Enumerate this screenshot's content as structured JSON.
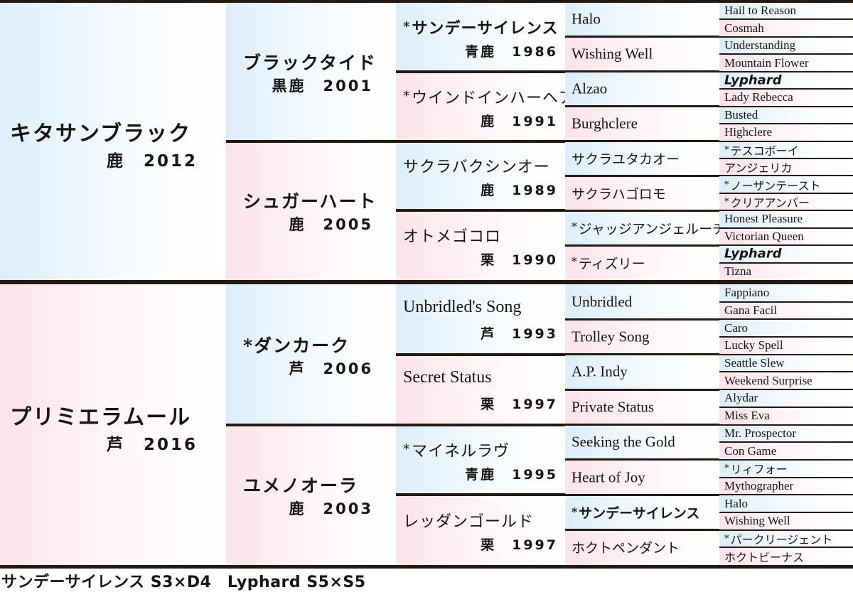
{
  "meta": {
    "accent_blue": "#ddeefb",
    "accent_pink": "#fbe3ea",
    "rule_color": "#241a14"
  },
  "gen1": [
    {
      "name": "キタサンブラック",
      "coat": "鹿",
      "year": "2012",
      "sex": "male"
    },
    {
      "name": "プリミエラムール",
      "coat": "芦",
      "year": "2016",
      "sex": "female"
    }
  ],
  "gen2": [
    {
      "name": "ブラックタイド",
      "coat": "黒鹿",
      "year": "2001",
      "sex": "male"
    },
    {
      "name": "シュガーハート",
      "coat": "鹿",
      "year": "2005",
      "sex": "female"
    },
    {
      "name": "*ダンカーク",
      "coat": "芦",
      "year": "2006",
      "sex": "male"
    },
    {
      "name": "ユメノオーラ",
      "coat": "鹿",
      "year": "2003",
      "sex": "female"
    }
  ],
  "gen3": [
    {
      "name": "サンデーサイレンス",
      "star": true,
      "bold": true,
      "script": "jp",
      "coat": "青鹿",
      "year": "1986",
      "sex": "male"
    },
    {
      "name": "ウインドインハーヘア",
      "star": true,
      "bold": false,
      "script": "jp",
      "coat": "鹿",
      "year": "1991",
      "sex": "female"
    },
    {
      "name": "サクラバクシンオー",
      "star": false,
      "bold": false,
      "script": "jp",
      "coat": "鹿",
      "year": "1989",
      "sex": "male"
    },
    {
      "name": "オトメゴコロ",
      "star": false,
      "bold": false,
      "script": "jp",
      "coat": "栗",
      "year": "1990",
      "sex": "female"
    },
    {
      "name": "Unbridled's Song",
      "star": false,
      "bold": false,
      "script": "en",
      "coat": "芦",
      "year": "1993",
      "sex": "male"
    },
    {
      "name": "Secret Status",
      "star": false,
      "bold": false,
      "script": "en",
      "coat": "栗",
      "year": "1997",
      "sex": "female"
    },
    {
      "name": "マイネルラヴ",
      "star": true,
      "bold": false,
      "script": "jp",
      "coat": "青鹿",
      "year": "1995",
      "sex": "male"
    },
    {
      "name": "レッダンゴールド",
      "star": false,
      "bold": false,
      "script": "jp",
      "coat": "栗",
      "year": "1997",
      "sex": "female"
    }
  ],
  "gen4": [
    {
      "name": "Halo",
      "star": false,
      "bold": false,
      "script": "en",
      "sex": "male"
    },
    {
      "name": "Wishing Well",
      "star": false,
      "bold": false,
      "script": "en",
      "sex": "female"
    },
    {
      "name": "Alzao",
      "star": false,
      "bold": false,
      "script": "en",
      "sex": "male"
    },
    {
      "name": "Burghclere",
      "star": false,
      "bold": false,
      "script": "en",
      "sex": "female"
    },
    {
      "name": "サクラユタカオー",
      "star": false,
      "bold": false,
      "script": "jp",
      "sex": "male"
    },
    {
      "name": "サクラハゴロモ",
      "star": false,
      "bold": false,
      "script": "jp",
      "sex": "female"
    },
    {
      "name": "ジャッジアンジェルーチ",
      "star": true,
      "bold": false,
      "script": "jp",
      "sex": "male"
    },
    {
      "name": "ティズリー",
      "star": true,
      "bold": false,
      "script": "jp",
      "sex": "female"
    },
    {
      "name": "Unbridled",
      "star": false,
      "bold": false,
      "script": "en",
      "sex": "male"
    },
    {
      "name": "Trolley Song",
      "star": false,
      "bold": false,
      "script": "en",
      "sex": "female"
    },
    {
      "name": "A.P. Indy",
      "star": false,
      "bold": false,
      "script": "en",
      "sex": "male"
    },
    {
      "name": "Private Status",
      "star": false,
      "bold": false,
      "script": "en",
      "sex": "female"
    },
    {
      "name": "Seeking the Gold",
      "star": false,
      "bold": false,
      "script": "en",
      "sex": "male"
    },
    {
      "name": "Heart of Joy",
      "star": false,
      "bold": false,
      "script": "en",
      "sex": "female"
    },
    {
      "name": "サンデーサイレンス",
      "star": true,
      "bold": true,
      "script": "jp",
      "sex": "male"
    },
    {
      "name": "ホクトペンダント",
      "star": false,
      "bold": false,
      "script": "jp",
      "sex": "female"
    }
  ],
  "gen5": [
    {
      "name": "Hail to Reason",
      "star": false,
      "script": "en",
      "highlight": false,
      "sex": "male"
    },
    {
      "name": "Cosmah",
      "star": false,
      "script": "en",
      "highlight": false,
      "sex": "female"
    },
    {
      "name": "Understanding",
      "star": false,
      "script": "en",
      "highlight": false,
      "sex": "male"
    },
    {
      "name": "Mountain Flower",
      "star": false,
      "script": "en",
      "highlight": false,
      "sex": "female"
    },
    {
      "name": "Lyphard",
      "star": false,
      "script": "en",
      "highlight": true,
      "sex": "male"
    },
    {
      "name": "Lady Rebecca",
      "star": false,
      "script": "en",
      "highlight": false,
      "sex": "female"
    },
    {
      "name": "Busted",
      "star": false,
      "script": "en",
      "highlight": false,
      "sex": "male"
    },
    {
      "name": "Highclere",
      "star": false,
      "script": "en",
      "highlight": false,
      "sex": "female"
    },
    {
      "name": "テスコボーイ",
      "star": true,
      "script": "jp",
      "highlight": false,
      "sex": "male"
    },
    {
      "name": "アンジェリカ",
      "star": false,
      "script": "jp",
      "highlight": false,
      "sex": "female"
    },
    {
      "name": "ノーザンテースト",
      "star": true,
      "script": "jp",
      "highlight": false,
      "sex": "male"
    },
    {
      "name": "クリアアンバー",
      "star": true,
      "script": "jp",
      "highlight": false,
      "sex": "female"
    },
    {
      "name": "Honest Pleasure",
      "star": false,
      "script": "en",
      "highlight": false,
      "sex": "male"
    },
    {
      "name": "Victorian Queen",
      "star": false,
      "script": "en",
      "highlight": false,
      "sex": "female"
    },
    {
      "name": "Lyphard",
      "star": false,
      "script": "en",
      "highlight": true,
      "sex": "male"
    },
    {
      "name": "Tizna",
      "star": false,
      "script": "en",
      "highlight": false,
      "sex": "female"
    },
    {
      "name": "Fappiano",
      "star": false,
      "script": "en",
      "highlight": false,
      "sex": "male"
    },
    {
      "name": "Gana Facil",
      "star": false,
      "script": "en",
      "highlight": false,
      "sex": "female"
    },
    {
      "name": "Caro",
      "star": false,
      "script": "en",
      "highlight": false,
      "sex": "male"
    },
    {
      "name": "Lucky Spell",
      "star": false,
      "script": "en",
      "highlight": false,
      "sex": "female"
    },
    {
      "name": "Seattle Slew",
      "star": false,
      "script": "en",
      "highlight": false,
      "sex": "male"
    },
    {
      "name": "Weekend Surprise",
      "star": false,
      "script": "en",
      "highlight": false,
      "sex": "female"
    },
    {
      "name": "Alydar",
      "star": false,
      "script": "en",
      "highlight": false,
      "sex": "male"
    },
    {
      "name": "Miss Eva",
      "star": false,
      "script": "en",
      "highlight": false,
      "sex": "female"
    },
    {
      "name": "Mr. Prospector",
      "star": false,
      "script": "en",
      "highlight": false,
      "sex": "male"
    },
    {
      "name": "Con Game",
      "star": false,
      "script": "en",
      "highlight": false,
      "sex": "female"
    },
    {
      "name": "リィフォー",
      "star": true,
      "script": "jp",
      "highlight": false,
      "sex": "male"
    },
    {
      "name": "Mythographer",
      "star": false,
      "script": "en",
      "highlight": false,
      "sex": "female"
    },
    {
      "name": "Halo",
      "star": false,
      "script": "en",
      "highlight": false,
      "sex": "male"
    },
    {
      "name": "Wishing Well",
      "star": false,
      "script": "en",
      "highlight": false,
      "sex": "female"
    },
    {
      "name": "パークリージェント",
      "star": true,
      "script": "jp",
      "highlight": false,
      "sex": "male"
    },
    {
      "name": "ホクトビーナス",
      "star": false,
      "script": "jp",
      "highlight": false,
      "sex": "female"
    }
  ],
  "footer": {
    "inbreeding": "サンデーサイレンス S3×D4　Lyphard S5×S5"
  }
}
